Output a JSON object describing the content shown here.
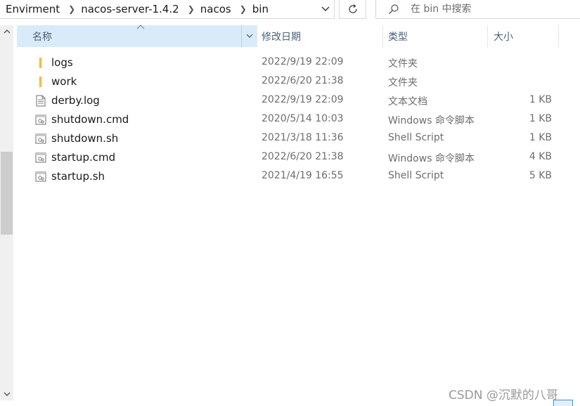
{
  "address": {
    "crumbs": [
      "Envirment",
      "nacos-server-1.4.2",
      "nacos",
      "bin"
    ]
  },
  "search": {
    "placeholder": "在 bin 中搜索"
  },
  "columns": {
    "name": "名称",
    "date": "修改日期",
    "type": "类型",
    "size": "大小"
  },
  "files": [
    {
      "name": "logs",
      "date": "2022/9/19 22:09",
      "type": "文件夹",
      "size": "",
      "icon": "folder-icon"
    },
    {
      "name": "work",
      "date": "2022/6/20 21:38",
      "type": "文件夹",
      "size": "",
      "icon": "folder-icon"
    },
    {
      "name": "derby.log",
      "date": "2022/9/19 22:09",
      "type": "文本文档",
      "size": "1 KB",
      "icon": "text-file-icon"
    },
    {
      "name": "shutdown.cmd",
      "date": "2020/5/14 10:03",
      "type": "Windows 命令脚本",
      "size": "1 KB",
      "icon": "script-file-icon"
    },
    {
      "name": "shutdown.sh",
      "date": "2021/3/18 11:36",
      "type": "Shell Script",
      "size": "1 KB",
      "icon": "script-file-icon"
    },
    {
      "name": "startup.cmd",
      "date": "2022/6/20 21:38",
      "type": "Windows 命令脚本",
      "size": "4 KB",
      "icon": "script-file-icon"
    },
    {
      "name": "startup.sh",
      "date": "2021/4/19 16:55",
      "type": "Shell Script",
      "size": "5 KB",
      "icon": "script-file-icon"
    }
  ],
  "watermark": "CSDN @沉默的八哥",
  "colors": {
    "header_selected": "#d9ebf9",
    "folder": "#f8d775",
    "scroll_thumb": "#cdcdcd"
  }
}
